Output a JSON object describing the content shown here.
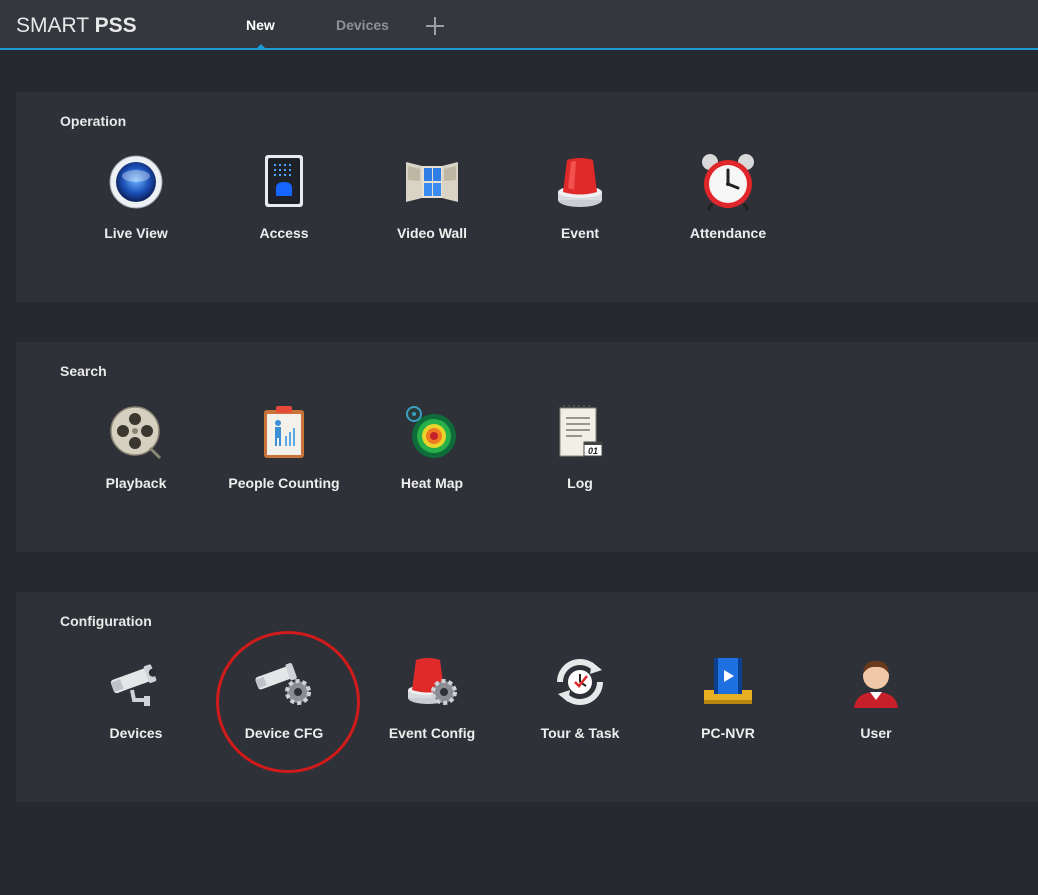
{
  "app": {
    "logo_light": "SMART ",
    "logo_bold": "PSS"
  },
  "tabs": [
    {
      "label": "New",
      "active": true
    },
    {
      "label": "Devices",
      "active": false
    }
  ],
  "add_tab_icon": "plus-icon",
  "accent_color": "#1c9ad6",
  "highlight_color": "#d11b1b",
  "sections": {
    "operation": {
      "title": "Operation",
      "items": [
        {
          "label": "Live View",
          "icon": "live-view-icon"
        },
        {
          "label": "Access",
          "icon": "access-icon"
        },
        {
          "label": "Video Wall",
          "icon": "video-wall-icon"
        },
        {
          "label": "Event",
          "icon": "alarm-light-icon"
        },
        {
          "label": "Attendance",
          "icon": "alarm-clock-icon"
        }
      ]
    },
    "search": {
      "title": "Search",
      "items": [
        {
          "label": "Playback",
          "icon": "film-reel-icon"
        },
        {
          "label": "People Counting",
          "icon": "people-counting-icon"
        },
        {
          "label": "Heat Map",
          "icon": "heat-map-icon"
        },
        {
          "label": "Log",
          "icon": "log-icon",
          "badge": "01"
        }
      ]
    },
    "configuration": {
      "title": "Configuration",
      "items": [
        {
          "label": "Devices",
          "icon": "camera-icon"
        },
        {
          "label": "Device CFG",
          "icon": "camera-gear-icon",
          "highlighted": true
        },
        {
          "label": "Event Config",
          "icon": "alarm-gear-icon"
        },
        {
          "label": "Tour & Task",
          "icon": "tour-task-icon"
        },
        {
          "label": "PC-NVR",
          "icon": "pc-nvr-icon"
        },
        {
          "label": "User",
          "icon": "user-icon"
        }
      ]
    }
  }
}
